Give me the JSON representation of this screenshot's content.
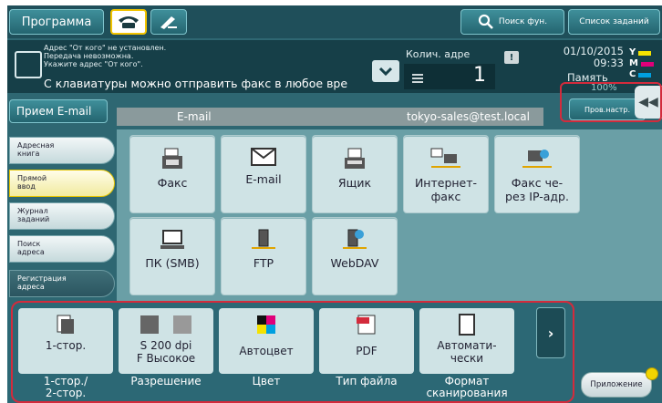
{
  "topbar": {
    "program_label": "Программа",
    "search_label": "Поиск фун.",
    "joblist_label": "Список заданий"
  },
  "status": {
    "messages": "Адрес \"От кого\" не установлен.\nПередача невозможна.\nУкажите адрес \"От кого\".",
    "main_message": "С клавиатуры можно отправить факс в любое вре",
    "copies_label": "Колич. адре",
    "copies_value": "1",
    "date": "01/10/2015",
    "time": "09:33",
    "memory_label": "Память",
    "usage_percent": "100%",
    "toner": [
      {
        "letter": "Y",
        "color": "#f4e200"
      },
      {
        "letter": "M",
        "color": "#e0007a"
      },
      {
        "letter": "C",
        "color": "#00a0e0"
      }
    ]
  },
  "email_row": {
    "receive_button": "Прием E-mail",
    "field_label": "E-mail",
    "field_value": "tokyo-sales@test.local",
    "check_button": "Пров.настр."
  },
  "sidebar": {
    "items": [
      {
        "label": "Адресная\nкнига"
      },
      {
        "label": "Прямой\nввод"
      },
      {
        "label": "Журнал\nзаданий"
      },
      {
        "label": "Поиск\nадреса"
      },
      {
        "label": "Регистрация\nадреса"
      }
    ]
  },
  "destinations": [
    {
      "label": "Факс",
      "icon": "fax-icon"
    },
    {
      "label": "E-mail",
      "icon": "envelope-icon"
    },
    {
      "label": "Ящик",
      "icon": "box-icon"
    },
    {
      "label": "Интернет-\nфакс",
      "icon": "internet-fax-icon"
    },
    {
      "label": "Факс че-\nрез IP-адр.",
      "icon": "ip-fax-icon"
    },
    {
      "label": "ПК (SMB)",
      "icon": "pc-icon"
    },
    {
      "label": "FTP",
      "icon": "ftp-server-icon"
    },
    {
      "label": "WebDAV",
      "icon": "webdav-icon"
    }
  ],
  "settings": [
    {
      "value": "1-стор.",
      "label": "1-стор./\n2-стор.",
      "icon": "simplex-icon"
    },
    {
      "value": "S 200 dpi\nF Высокое",
      "label": "Разрешение",
      "icon": "resolution-icon"
    },
    {
      "value": "Автоцвет",
      "label": "Цвет",
      "icon": "color-icon"
    },
    {
      "value": "PDF",
      "label": "Тип файла",
      "icon": "pdf-icon"
    },
    {
      "value": "Автомати-\nчески",
      "label": "Формат\nсканирования",
      "icon": "page-size-icon"
    }
  ],
  "applications_label": "Приложение",
  "colors": {
    "background": "#2e6772",
    "active_yellow": "#f2c400",
    "highlight_red": "#d32b3c"
  }
}
